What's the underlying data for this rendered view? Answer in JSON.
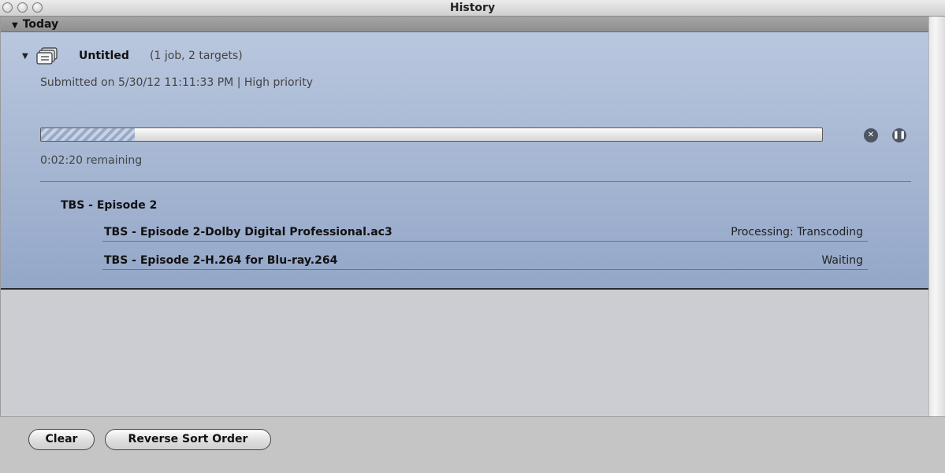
{
  "window": {
    "title": "History"
  },
  "group": {
    "label": "Today"
  },
  "job": {
    "name": "Untitled",
    "meta": "(1 job, 2 targets)",
    "submitted": "Submitted on 5/30/12 11:11:33 PM  |  High priority",
    "progress_fraction": 0.12,
    "remaining": "0:02:20 remaining",
    "source": "TBS - Episode 2",
    "targets": [
      {
        "name": "TBS - Episode 2-Dolby Digital Professional.ac3",
        "status": "Processing: Transcoding"
      },
      {
        "name": "TBS - Episode 2-H.264 for Blu-ray.264",
        "status": "Waiting"
      }
    ]
  },
  "buttons": {
    "clear": "Clear",
    "reverse": "Reverse Sort Order"
  },
  "colors": {
    "job_bg": "#a8b8d4",
    "group_header": "#9a9a9a",
    "ctrl": "#4e5563"
  }
}
